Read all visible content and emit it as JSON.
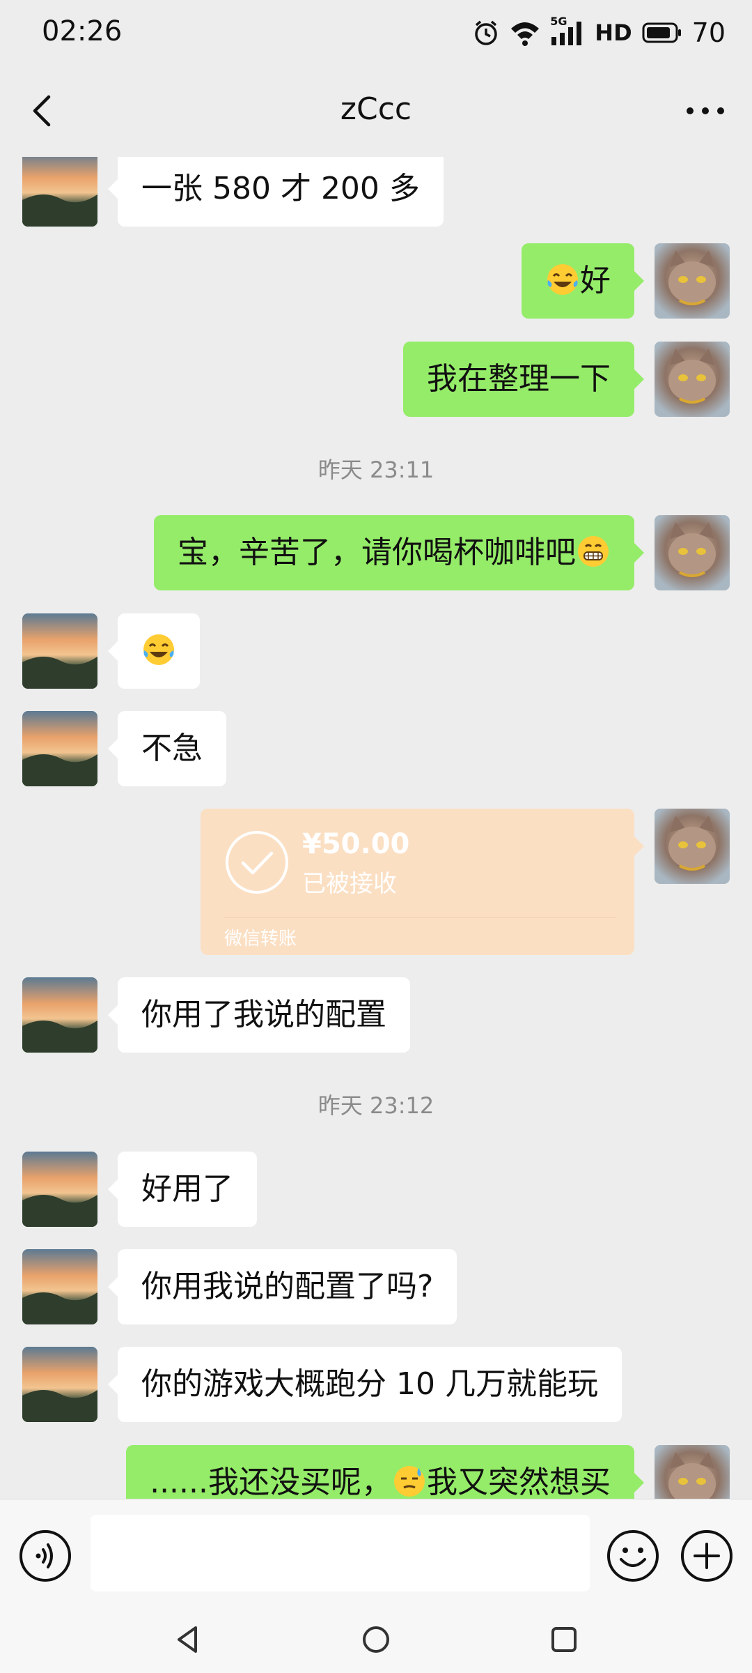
{
  "status_bar": {
    "time": "02:26",
    "network_label": "5G",
    "hd_label": "HD",
    "battery_level": "70"
  },
  "header": {
    "title": "zCcc"
  },
  "messages": [
    {
      "side": "in",
      "text": "一张 580 才 200 多"
    },
    {
      "side": "out",
      "text": "好",
      "emoji": "laughing-tears-emoji"
    },
    {
      "side": "out",
      "text": "我在整理一下"
    },
    {
      "type": "time",
      "text": "昨天 23:11"
    },
    {
      "side": "out",
      "text": "宝，辛苦了，请你喝杯咖啡吧",
      "emoji": "grinning-emoji"
    },
    {
      "side": "in",
      "text": "",
      "emoji": "laughing-tears-emoji"
    },
    {
      "side": "in",
      "text": "不急"
    },
    {
      "side": "out",
      "type": "transfer",
      "amount": "¥50.00",
      "status": "已被接收",
      "label": "微信转账"
    },
    {
      "side": "in",
      "text": "你用了我说的配置"
    },
    {
      "type": "time",
      "text": "昨天 23:12"
    },
    {
      "side": "in",
      "text": "好用了"
    },
    {
      "side": "in",
      "text": "你用我说的配置了吗?"
    },
    {
      "side": "in",
      "text": "你的游戏大概跑分 10 几万就能玩"
    },
    {
      "side": "out",
      "text_before": "......我还没买呢，",
      "text_after": "我又突然想买",
      "emoji": "sweat-emoji"
    }
  ],
  "colors": {
    "background": "#EDEDED",
    "outgoing_bubble": "#95EC69",
    "incoming_bubble": "#FFFFFF",
    "transfer_card": "#FBDFC3"
  }
}
